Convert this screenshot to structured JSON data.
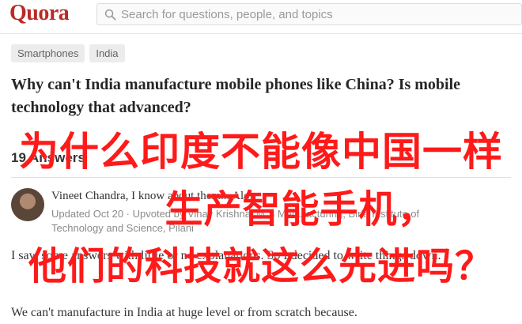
{
  "header": {
    "logo": "Quora",
    "search_placeholder": "Search for questions, people, and topics"
  },
  "topics": [
    "Smartphones",
    "India"
  ],
  "question": {
    "title": "Why can't India manufacture mobile phones like China? Is mobile technology that advanced?"
  },
  "answers_count": "19 Answers",
  "answer": {
    "author": "Vineet Chandra, I know about them... Alot.",
    "credentials": "Updated Oct 20 · Upvoted by Vinay Krishna, M.S Manufacturing, Birla Institute of Technology and Science, Pilani",
    "paragraph1": "I saw some answers with little or no explanations. So I decided to write things down.",
    "paragraph2": "We can't manufacture in India at huge level or from scratch because."
  },
  "overlay": {
    "line1": "为什么印度不能像中国一样",
    "line2": "生产智能手机，",
    "line3": "他们的科技就这么先进吗？",
    "color": "#ff1a1a"
  },
  "colors": {
    "brand": "#b92b27"
  }
}
